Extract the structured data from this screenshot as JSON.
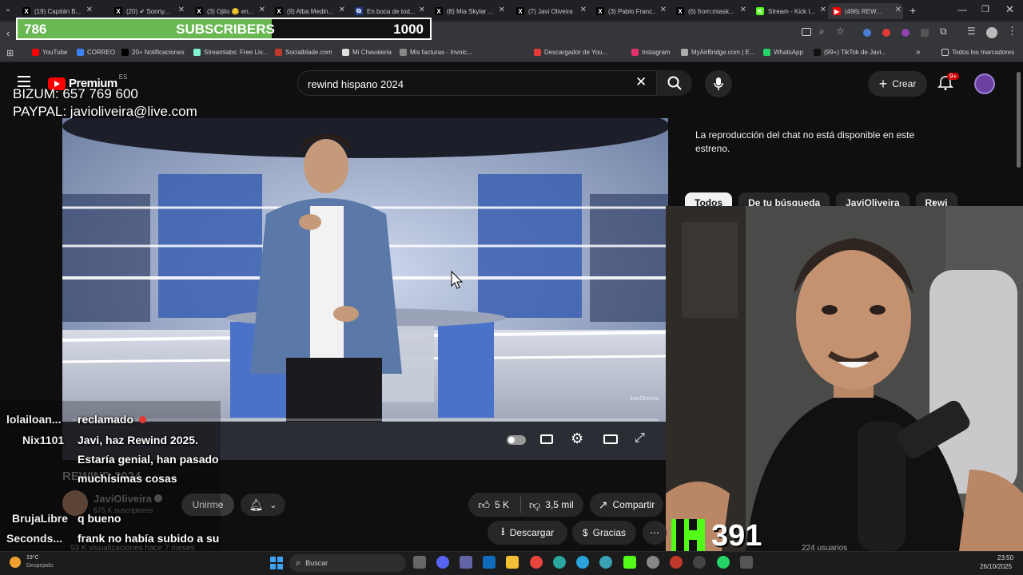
{
  "browser": {
    "tabs": [
      {
        "title": "(19) Capitán B...",
        "fav": "X",
        "color": "#000"
      },
      {
        "title": "(20) ✔ Sonny...",
        "fav": "X",
        "color": "#000"
      },
      {
        "title": "(3) Ojito 😏 en...",
        "fav": "X",
        "color": "#000"
      },
      {
        "title": "(9) Alba Medin...",
        "fav": "X",
        "color": "#000"
      },
      {
        "title": "En boca de tod...",
        "fav": "⧉",
        "color": "#1e3a8a"
      },
      {
        "title": "(8) Mia Skylar ...",
        "fav": "X",
        "color": "#000"
      },
      {
        "title": "(7) Javi Oliveira",
        "fav": "X",
        "color": "#000"
      },
      {
        "title": "(3) Pablo Franc...",
        "fav": "X",
        "color": "#000"
      },
      {
        "title": "(6) from:miask...",
        "fav": "X",
        "color": "#000"
      },
      {
        "title": "Stream - Kick I...",
        "fav": "K",
        "color": "#53fc18"
      },
      {
        "title": "(496) REW...",
        "fav": "▶",
        "color": "#ff0000"
      }
    ],
    "new_tab": "+",
    "bookmarks": [
      {
        "label": "YouTube",
        "color": "#ff0000"
      },
      {
        "label": "CORREO",
        "color": "#3b82f6"
      },
      {
        "label": "20+ Notificaciones",
        "color": "#000"
      },
      {
        "label": "Streamlabs: Free Liv...",
        "color": "#80f5d2"
      },
      {
        "label": "Socialblade.com",
        "color": "#c0392b"
      },
      {
        "label": "Mi Chavaleria",
        "color": "#ddd"
      },
      {
        "label": "Mis facturas - Invoic...",
        "color": "#888"
      },
      {
        "label": "Descargador de You...",
        "color": "#e53935"
      },
      {
        "label": "Instagram",
        "color": "#e1306c"
      },
      {
        "label": "MyAirBridge.com | E...",
        "color": "#aaa"
      },
      {
        "label": "WhatsApp",
        "color": "#25d366"
      },
      {
        "label": "(99+) TikTok de Javi...",
        "color": "#111"
      }
    ],
    "all_bookmarks": "Todos los marcadores"
  },
  "overlay": {
    "sub_count": "786",
    "sub_label": "SUBSCRIBERS",
    "sub_goal": "1000",
    "sub_progress": 0.786,
    "bizum": "BIZUM: 657 769 600",
    "paypal": "PAYPAL: javioliveira@live.com",
    "kick_count": "391"
  },
  "youtube": {
    "logo": "Premium",
    "logo_region": "ES",
    "search_value": "rewind hispano 2024",
    "create_label": "Crear",
    "notif_badge": "9+",
    "chat_notice": "La reproducción del chat no está disponible en este estreno.",
    "chips": [
      "Todos",
      "De tu búsqueda",
      "JaviOliveira",
      "Rewi"
    ],
    "video_title": "REWIND 2024",
    "channel_name": "JaviOliveira",
    "subscribers": "675 K suscriptores",
    "join_label": "Unirme",
    "likes": "5 K",
    "dislikes": "3,5 mil",
    "share_label": "Compartir",
    "download_label": "Descargar",
    "thanks_label": "Gracias",
    "more_label": "⋯",
    "views": "93 K visualizaciones  hace 7 meses",
    "viewers_partial": "224 usuarios",
    "watermark": "JaviOliveira"
  },
  "chat": [
    {
      "user": "lolailoan...",
      "color": "#e8d44d",
      "msg": "reclamado"
    },
    {
      "user": "Nix1101",
      "color": "#e8d44d",
      "msg": "Javi, haz Rewind 2025. Estaría genial, han pasado muchísimas cosas"
    },
    {
      "user": "BrujaLibre",
      "color": "#e53935",
      "msg": "q bueno"
    },
    {
      "user": "Seconds...",
      "color": "#e8d44d",
      "msg": "frank no había subido a su tuiter el original?"
    }
  ],
  "taskbar": {
    "weather_temp": "19°C",
    "weather_desc": "Despejado",
    "search_placeholder": "Buscar",
    "time": "23:50",
    "date": "26/10/2025"
  }
}
